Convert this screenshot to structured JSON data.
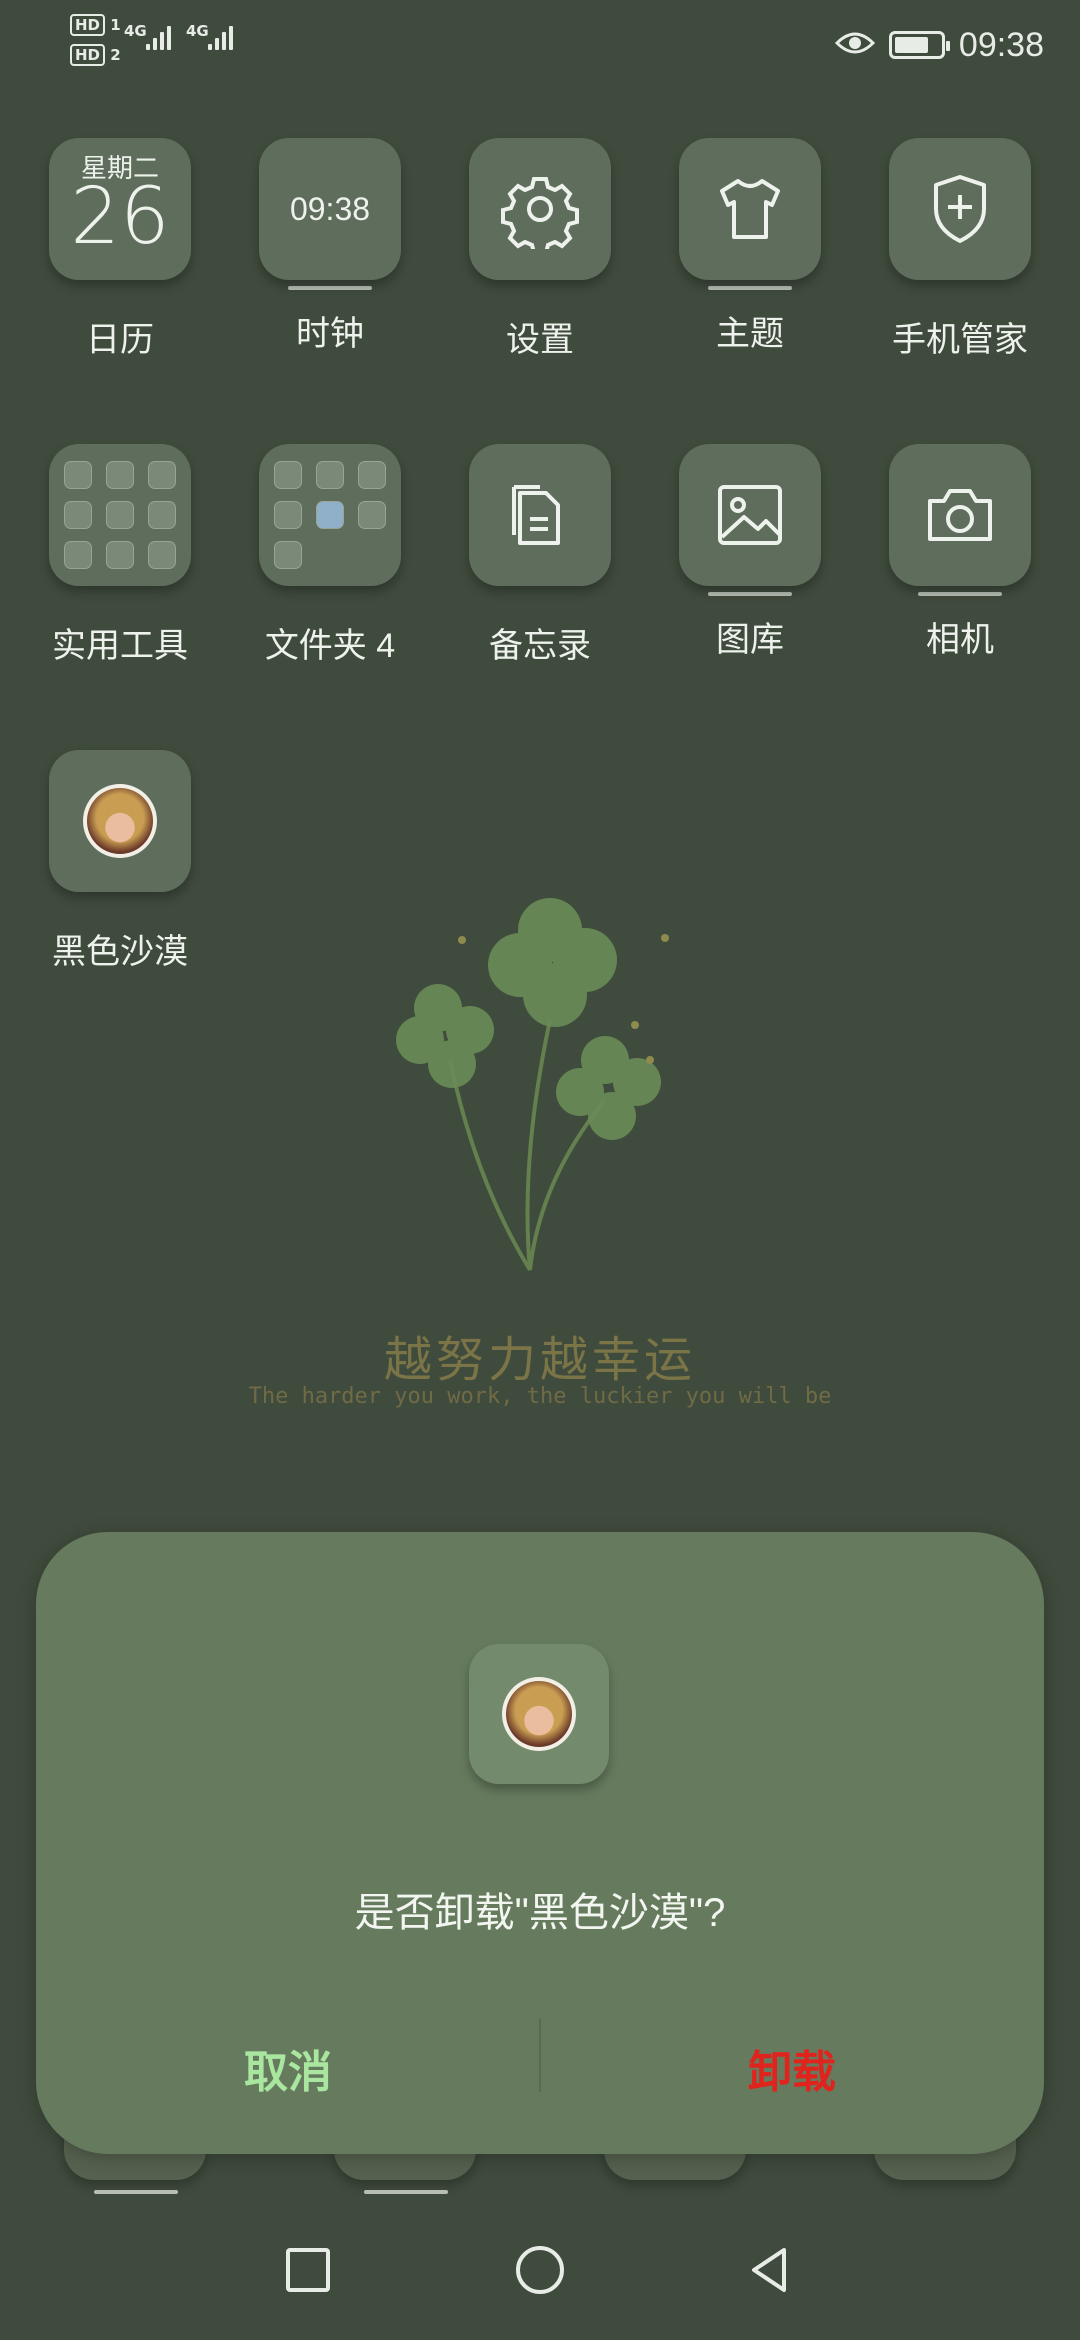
{
  "status_bar": {
    "sim1": "HD",
    "sim1_index": "1",
    "sim2": "HD",
    "sim2_index": "2",
    "net1": "4G",
    "net2": "4G",
    "time": "09:38",
    "eye_icon": "eye-icon",
    "battery_level": 0.75
  },
  "apps": [
    {
      "name": "日历",
      "icon": "calendar-icon",
      "weekday": "星期二",
      "day": "26"
    },
    {
      "name": "时钟",
      "icon": "clock-icon",
      "time": "09:38"
    },
    {
      "name": "设置",
      "icon": "gear-icon"
    },
    {
      "name": "主题",
      "icon": "tshirt-icon"
    },
    {
      "name": "手机管家",
      "icon": "shield-plus-icon"
    },
    {
      "name": "实用工具",
      "icon": "folder-icon"
    },
    {
      "name": "文件夹 4",
      "icon": "folder-icon"
    },
    {
      "name": "备忘录",
      "icon": "notes-icon"
    },
    {
      "name": "图库",
      "icon": "gallery-icon"
    },
    {
      "name": "相机",
      "icon": "camera-icon"
    },
    {
      "name": "黑色沙漠",
      "icon": "game-avatar-icon"
    }
  ],
  "wallpaper": {
    "motto_cn": "越努力越幸运",
    "motto_en": "The harder you work, the luckier you will be"
  },
  "dialog": {
    "message": "是否卸载\"黑色沙漠\"?",
    "cancel_label": "取消",
    "uninstall_label": "卸载",
    "cancel_color": "#a9e6a0",
    "uninstall_color": "#e0231c"
  },
  "nav": {
    "recent": "square-icon",
    "home": "circle-icon",
    "back": "triangle-back-icon"
  }
}
